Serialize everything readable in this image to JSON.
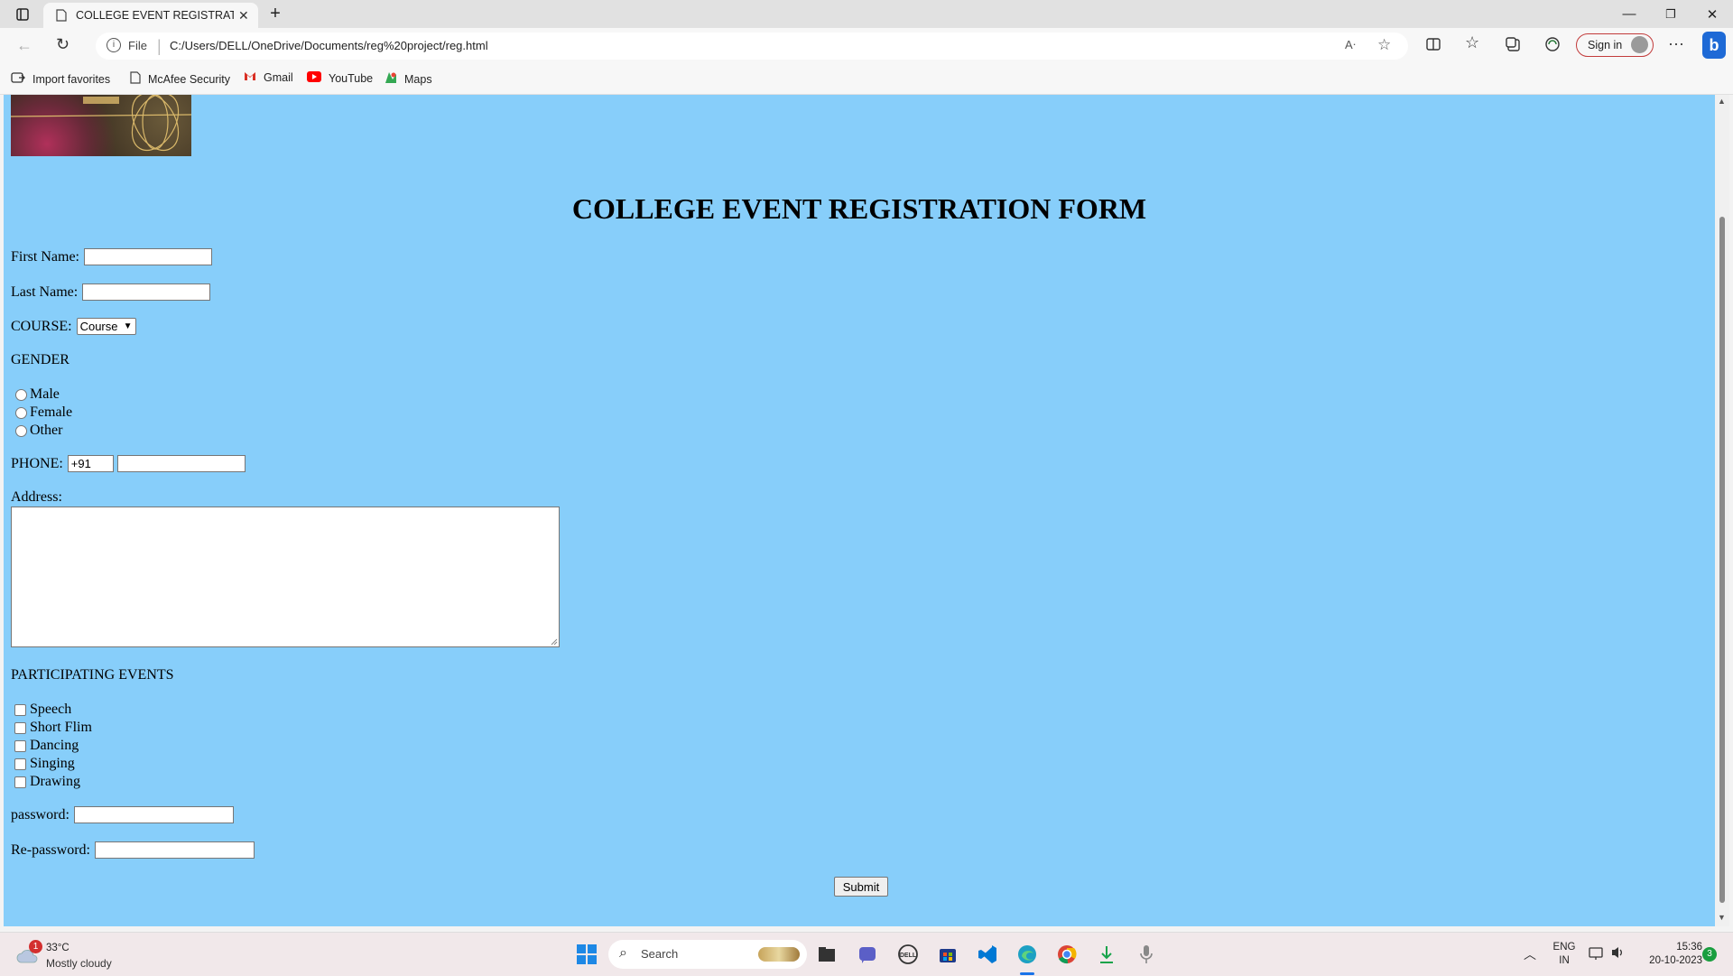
{
  "browser": {
    "tab_title": "COLLEGE EVENT REGISTRATION",
    "new_tab": "+",
    "url_scheme": "File",
    "url": "C:/Users/DELL/OneDrive/Documents/reg%20project/reg.html",
    "sign_in": "Sign in",
    "bookmarks": [
      "Import favorites",
      "McAfee Security",
      "Gmail",
      "YouTube",
      "Maps"
    ]
  },
  "page": {
    "heading": "COLLEGE EVENT REGISTRATION FORM",
    "first_name_label": "First Name:",
    "last_name_label": "Last Name:",
    "course_label": "COURSE:",
    "course_selected": "Course",
    "gender_label": "GENDER",
    "gender_options": [
      "Male",
      "Female",
      "Other"
    ],
    "phone_label": "PHONE:",
    "phone_code": "+91",
    "address_label": "Address:",
    "events_label": "PARTICIPATING EVENTS",
    "events": [
      "Speech",
      "Short Flim",
      "Dancing",
      "Singing",
      "Drawing"
    ],
    "password_label": "password:",
    "repassword_label": "Re-password:",
    "submit_label": "Submit"
  },
  "taskbar": {
    "weather_temp": "33°C",
    "weather_desc": "Mostly cloudy",
    "weather_badge": "1",
    "search_placeholder": "Search",
    "lang_line1": "ENG",
    "lang_line2": "IN",
    "time": "15:36",
    "date": "20-10-2023",
    "notification_count": "3"
  }
}
